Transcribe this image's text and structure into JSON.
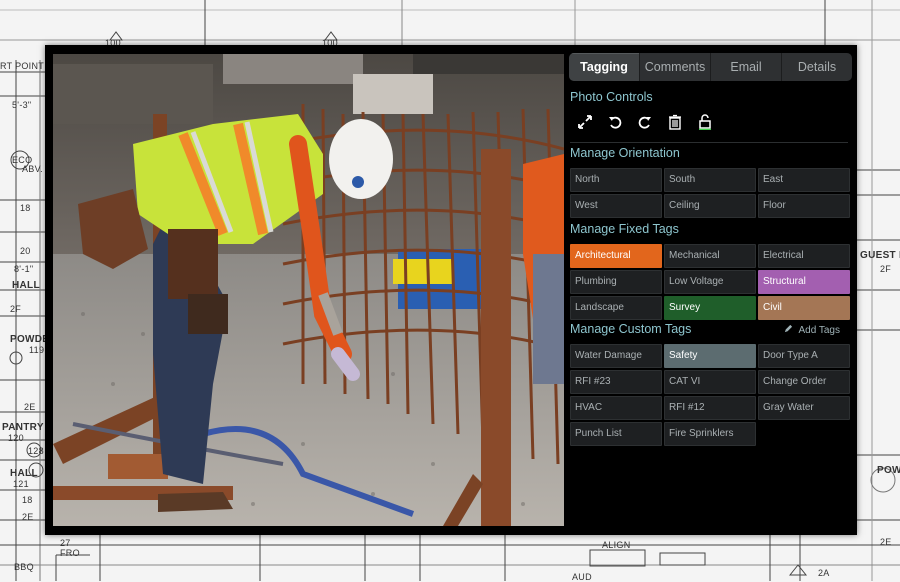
{
  "blueprint": {
    "labels": [
      "100",
      "100",
      "RT POINT",
      "5'-3\"",
      "ECO",
      "ABV.",
      "18",
      "20",
      "8'-1\"",
      "HALL",
      "2F",
      "POWDE",
      "119",
      "2E",
      "PANTRY",
      "120",
      "128",
      "HALL",
      "121",
      "18",
      "2E",
      "GUEST F",
      "2F",
      "POW",
      "2E",
      "ALIGN",
      "27",
      "FRO",
      "BBQ",
      "2A",
      "AUD"
    ]
  },
  "tabs": [
    {
      "label": "Tagging",
      "active": true
    },
    {
      "label": "Comments",
      "active": false
    },
    {
      "label": "Email",
      "active": false
    },
    {
      "label": "Details",
      "active": false
    }
  ],
  "photo_controls": {
    "title": "Photo Controls",
    "icons": [
      "expand-icon",
      "rotate-left-icon",
      "rotate-right-icon",
      "trash-icon",
      "unlock-icon"
    ]
  },
  "orientation": {
    "title": "Manage Orientation",
    "tags": [
      {
        "label": "North"
      },
      {
        "label": "South"
      },
      {
        "label": "East"
      },
      {
        "label": "West"
      },
      {
        "label": "Ceiling"
      },
      {
        "label": "Floor"
      }
    ]
  },
  "fixed_tags": {
    "title": "Manage Fixed Tags",
    "tags": [
      {
        "label": "Architectural",
        "selected": true,
        "color": "#e2661c"
      },
      {
        "label": "Mechanical",
        "selected": false
      },
      {
        "label": "Electrical",
        "selected": false
      },
      {
        "label": "Plumbing",
        "selected": false
      },
      {
        "label": "Low Voltage",
        "selected": false
      },
      {
        "label": "Structural",
        "selected": true,
        "color": "#a35fb0"
      },
      {
        "label": "Landscape",
        "selected": false
      },
      {
        "label": "Survey",
        "selected": true,
        "color": "#1f5e2a"
      },
      {
        "label": "Civil",
        "selected": true,
        "color": "#a47655"
      }
    ]
  },
  "custom_tags": {
    "title": "Manage Custom Tags",
    "add_label": "Add Tags",
    "tags": [
      {
        "label": "Water Damage",
        "selected": false
      },
      {
        "label": "Safety",
        "selected": true,
        "color": "#5c6c70"
      },
      {
        "label": "Door Type A",
        "selected": false
      },
      {
        "label": "RFI #23",
        "selected": false
      },
      {
        "label": "CAT VI",
        "selected": false
      },
      {
        "label": "Change Order",
        "selected": false
      },
      {
        "label": "HVAC",
        "selected": false
      },
      {
        "label": "RFI #12",
        "selected": false
      },
      {
        "label": "Gray Water",
        "selected": false
      },
      {
        "label": "Punch List",
        "selected": false
      },
      {
        "label": "Fire Sprinklers",
        "selected": false
      }
    ]
  },
  "colors": {
    "accent_title": "#8ec6cf",
    "panel_bg": "#000000"
  }
}
